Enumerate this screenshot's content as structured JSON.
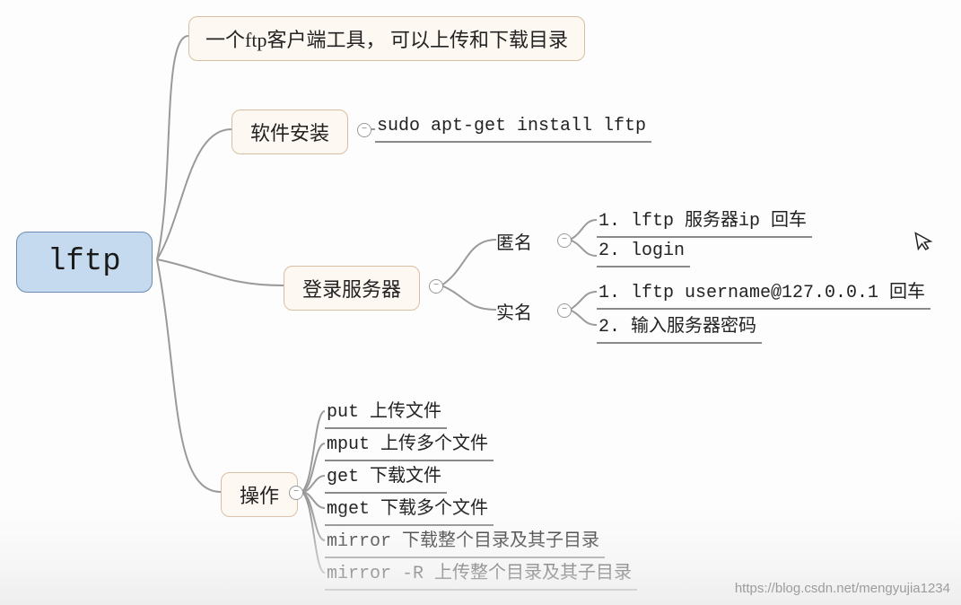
{
  "root": {
    "label": "lftp"
  },
  "description": "一个ftp客户端工具，  可以上传和下载目录",
  "install": {
    "label": "软件安装",
    "command": "sudo apt-get install lftp"
  },
  "login": {
    "label": "登录服务器",
    "anon": {
      "label": "匿名",
      "steps": [
        "1. lftp 服务器ip  回车",
        "2. login"
      ]
    },
    "real": {
      "label": "实名",
      "steps": [
        "1. lftp username@127.0.0.1 回车",
        "2. 输入服务器密码"
      ]
    }
  },
  "ops": {
    "label": "操作",
    "items": [
      "put 上传文件",
      "mput 上传多个文件",
      "get 下载文件",
      "mget 下载多个文件",
      "mirror 下载整个目录及其子目录",
      "mirror -R 上传整个目录及其子目录"
    ]
  },
  "watermark": "https://blog.csdn.net/mengyujia1234"
}
